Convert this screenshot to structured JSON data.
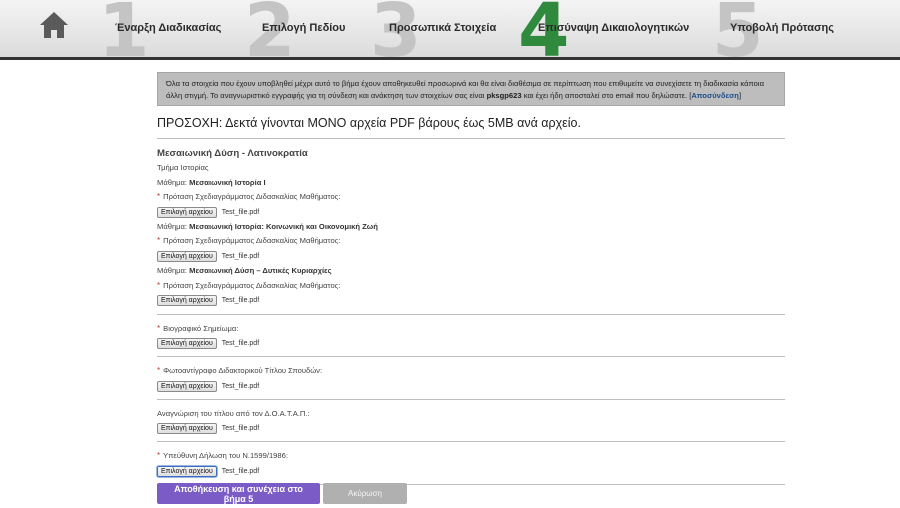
{
  "nav": {
    "home_icon": "home-icon",
    "steps": [
      {
        "number": "1",
        "label": "Έναρξη Διαδικασίας"
      },
      {
        "number": "2",
        "label": "Επιλογή Πεδίου"
      },
      {
        "number": "3",
        "label": "Προσωπικά Στοιχεία"
      },
      {
        "number": "4",
        "label": "Επισύναψη Δικαιολογητικών"
      },
      {
        "number": "5",
        "label": "Υποβολή Πρότασης"
      }
    ],
    "active_step": "4",
    "active_color": "#2f8a3e"
  },
  "notice": {
    "text": "Όλα τα στοιχεία που έχουν υποβληθεί μέχρι αυτό το βήμα έχουν αποθηκευθεί προσωρινά και θα είναι διαθέσιμα σε περίπτωση που επιθυμείτε να συνεχίσετε τη διαδικασία κάποια άλλη στιγμή. Το αναγνωριστικό εγγραφής για τη σύνδεση και ανάκτηση των στοιχείων σας είναι",
    "code": "pksgp623",
    "text2": "και έχει ήδη αποσταλεί στο email που δηλώσατε.",
    "bracket_open": "[",
    "logout": "Αποσύνδεση",
    "bracket_close": "]"
  },
  "warning": "ΠΡΟΣΟΧΗ: Δεκτά γίνονται ΜΟΝΟ αρχεία PDF βάρους έως 5MB ανά αρχείο.",
  "section": {
    "title": "Μεσαιωνική Δύση - Λατινοκρατία",
    "department": "Τμήμα Ιστορίας",
    "courses": [
      {
        "prefix": "Μάθημα:",
        "name": "Μεσαιωνική Ιστορία Ι",
        "doc_label": "Πρόταση Σχεδιαγράμματος Διδασκαλίας Μαθήματος:",
        "file": "Test_file.pdf"
      },
      {
        "prefix": "Μάθημα:",
        "name": "Μεσαιωνική Ιστορία: Κοινωνική και Οικονομική Ζωή",
        "doc_label": "Πρόταση Σχεδιαγράμματος Διδασκαλίας Μαθήματος:",
        "file": "Test_file.pdf"
      },
      {
        "prefix": "Μάθημα:",
        "name": "Μεσαιωνική Δύση – Δυτικές Κυριαρχίες",
        "doc_label": "Πρόταση Σχεδιαγράμματος Διδασκαλίας Μαθήματος:",
        "file": "Test_file.pdf"
      }
    ]
  },
  "documents": [
    {
      "label": "Βιογραφικό Σημείωμα:",
      "required": true,
      "file": "Test_file.pdf"
    },
    {
      "label": "Φωτοαντίγραφο Διδακτορικού Τίτλου Σπουδών:",
      "required": true,
      "file": "Test_file.pdf"
    },
    {
      "label": "Αναγνώριση του τίτλου από τον Δ.Ο.Α.Τ.Α.Π.:",
      "required": false,
      "file": "Test_file.pdf"
    },
    {
      "label": "Υπεύθυνη Δήλωση του Ν.1599/1986:",
      "required": true,
      "file": "Test_file.pdf"
    }
  ],
  "file_button_label": "Επιλογή αρχείου",
  "required_marker": "*",
  "actions": {
    "save_label": "Αποθήκευση και συνέχεια στο βήμα 5",
    "cancel_label": "Ακύρωση",
    "primary_color": "#7b5cc6"
  }
}
